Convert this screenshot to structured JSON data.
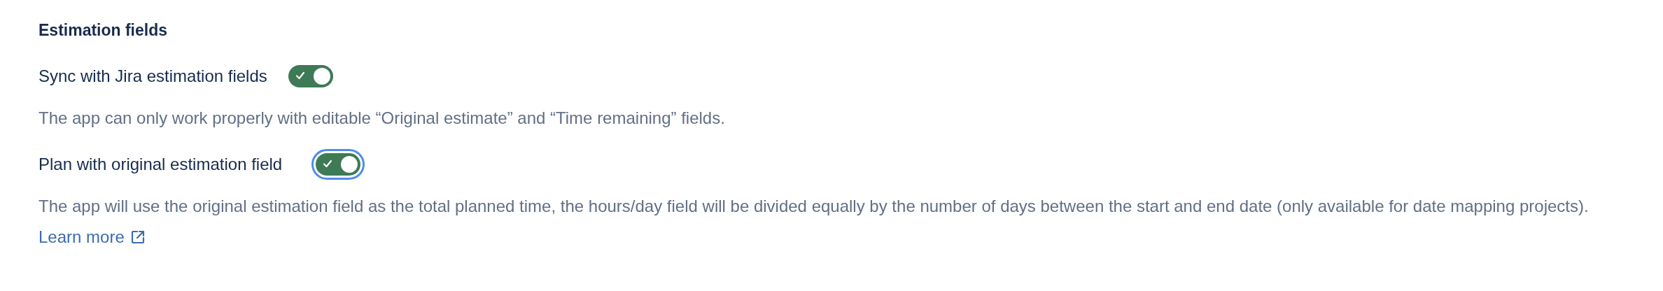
{
  "section": {
    "title": "Estimation fields"
  },
  "settings": [
    {
      "label": "Sync with Jira estimation fields",
      "on": true,
      "focused": false,
      "description": "The app can only work properly with editable “Original estimate” and “Time remaining” fields."
    },
    {
      "label": "Plan with original estimation field",
      "on": true,
      "focused": true,
      "description": "The app will use the original estimation field as the total planned time, the hours/day field will be divided equally by the number of days between the start and end date (only available for date mapping projects).",
      "link": "Learn more"
    }
  ]
}
